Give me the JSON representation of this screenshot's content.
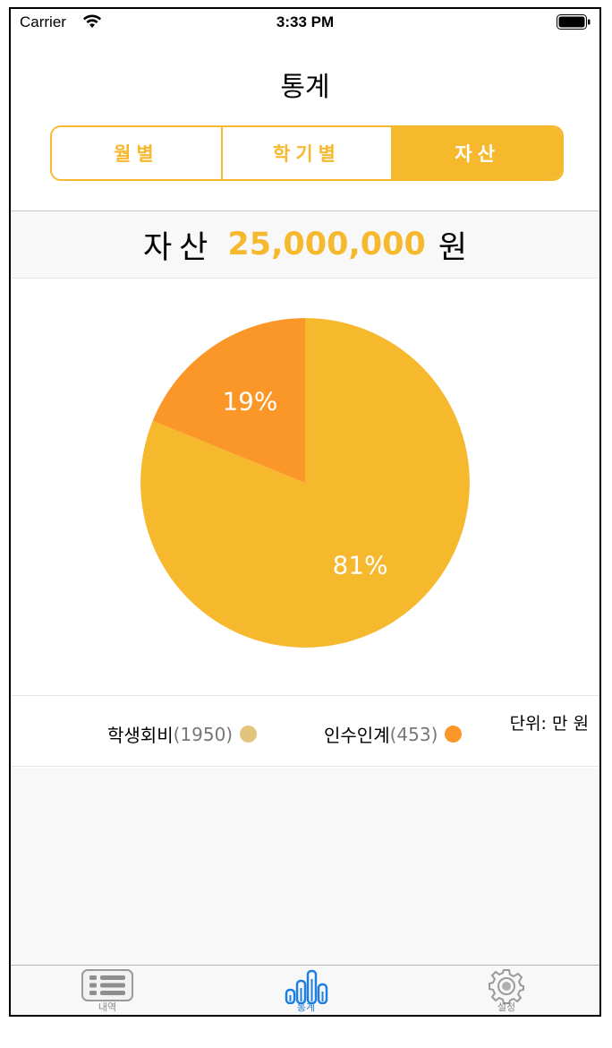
{
  "status_bar": {
    "carrier": "Carrier",
    "time": "3:33 PM"
  },
  "nav": {
    "title": "통계"
  },
  "segments": [
    {
      "label": "월별",
      "active": false
    },
    {
      "label": "학기별",
      "active": false
    },
    {
      "label": "자산",
      "active": true
    }
  ],
  "asset": {
    "label": "자산",
    "amount": "25,000,000",
    "currency": "원"
  },
  "chart_data": {
    "type": "pie",
    "labels": [
      "학생회비",
      "인수인계"
    ],
    "values": [
      1950,
      453
    ],
    "percent_labels": [
      "81%",
      "19%"
    ],
    "colors": [
      "#f6b82d",
      "#fb9628"
    ]
  },
  "legend": {
    "items": [
      {
        "name": "학생회비",
        "count": "(1950)",
        "color": "#e2c57d"
      },
      {
        "name": "인수인계",
        "count": " (453)",
        "color": "#fb9628"
      }
    ],
    "unit": "단위: 만 원"
  },
  "tabs": [
    {
      "label": "내역",
      "icon": "list-icon",
      "active": false
    },
    {
      "label": "통계",
      "icon": "bar-chart-icon",
      "active": true
    },
    {
      "label": "설정",
      "icon": "gear-icon",
      "active": false
    }
  ]
}
